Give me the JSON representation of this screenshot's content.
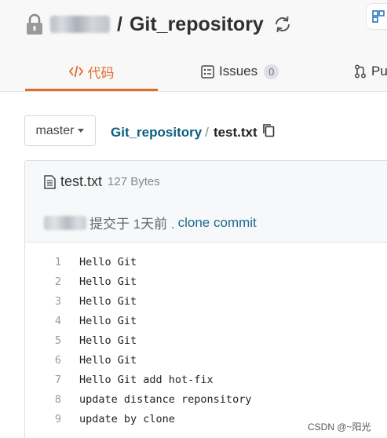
{
  "header": {
    "title_separator": "/",
    "repo_name": "Git_repository"
  },
  "tabs": [
    {
      "label": "代码",
      "active": true
    },
    {
      "label": "Issues",
      "badge": "0"
    },
    {
      "label": "Pu"
    }
  ],
  "branch": {
    "label": "master"
  },
  "breadcrumb": {
    "repo": "Git_repository",
    "separator": "/",
    "file": "test.txt"
  },
  "file": {
    "name": "test.txt",
    "size": "127 Bytes",
    "commit_text": "提交于 1天前 .",
    "commit_link": "clone commit"
  },
  "code_lines": [
    {
      "num": "1",
      "text": "Hello Git"
    },
    {
      "num": "2",
      "text": "Hello Git"
    },
    {
      "num": "3",
      "text": "Hello Git"
    },
    {
      "num": "4",
      "text": "Hello Git"
    },
    {
      "num": "5",
      "text": "Hello Git"
    },
    {
      "num": "6",
      "text": "Hello Git"
    },
    {
      "num": "7",
      "text": "Hello Git add hot-fix"
    },
    {
      "num": "8",
      "text": "update distance reponsitory"
    },
    {
      "num": "9",
      "text": "update by clone"
    }
  ],
  "watermark": "CSDN @~阳光",
  "colors": {
    "accent": "#e36b2c",
    "link": "#0c5f80"
  },
  "icons": {
    "lock": "lock-icon",
    "sync": "sync-icon",
    "code": "code-icon",
    "issues": "issues-icon",
    "pull": "pull-request-icon",
    "copy": "copy-icon",
    "file": "file-icon"
  }
}
